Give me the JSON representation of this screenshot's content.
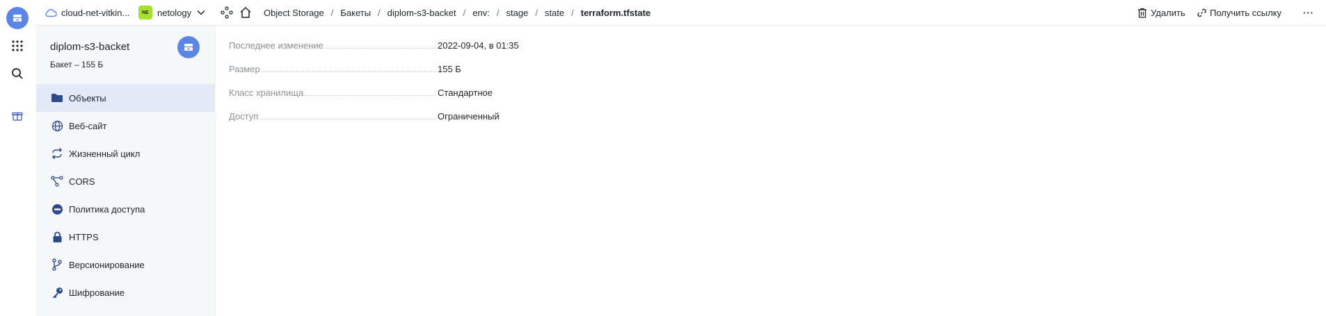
{
  "topbar": {
    "cloud_name": "cloud-net-vitkin...",
    "org_badge": "NE",
    "org_name": "netology",
    "breadcrumbs": [
      "Object Storage",
      "Бакеты",
      "diplom-s3-backet",
      "env:",
      "stage",
      "state",
      "terraform.tfstate"
    ],
    "separator": "/",
    "delete_label": "Удалить",
    "get_link_label": "Получить ссылку",
    "more_label": "···"
  },
  "sidebar": {
    "bucket_name": "diplom-s3-backet",
    "bucket_info": "Бакет – 155 Б",
    "items": [
      {
        "label": "Объекты",
        "icon": "folder-icon",
        "active": true
      },
      {
        "label": "Веб-сайт",
        "icon": "globe-icon"
      },
      {
        "label": "Жизненный цикл",
        "icon": "cycle-icon"
      },
      {
        "label": "CORS",
        "icon": "cors-icon"
      },
      {
        "label": "Политика доступа",
        "icon": "no-entry-icon"
      },
      {
        "label": "HTTPS",
        "icon": "lock-icon"
      },
      {
        "label": "Версионирование",
        "icon": "branch-icon"
      },
      {
        "label": "Шифрование",
        "icon": "key-icon"
      }
    ]
  },
  "properties": [
    {
      "key": "Последнее изменение",
      "value": "2022-09-04, в 01:35"
    },
    {
      "key": "Размер",
      "value": "155 Б"
    },
    {
      "key": "Класс хранилища",
      "value": "Стандартное"
    },
    {
      "key": "Доступ",
      "value": "Ограниченный"
    }
  ],
  "colors": {
    "accent": "#5b86e5",
    "sidebar_bg": "#f6f7f9",
    "active_bg": "#e3e9f6",
    "badge": "#a5e02f"
  }
}
